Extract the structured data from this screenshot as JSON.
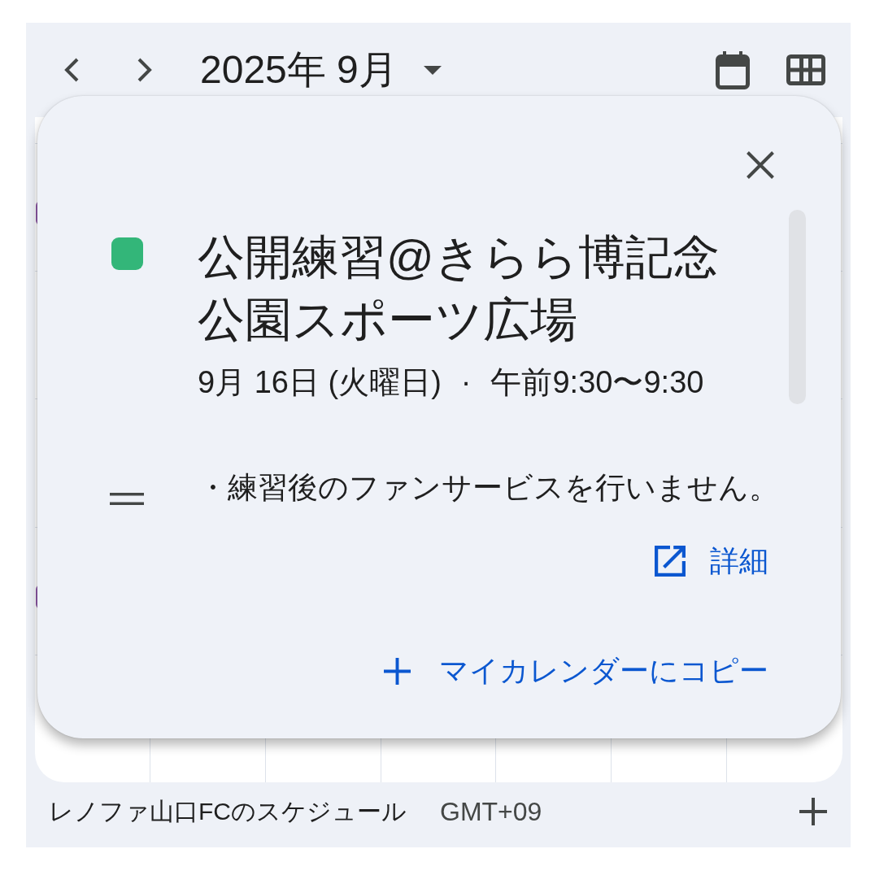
{
  "header": {
    "title": "2025年 9月"
  },
  "event": {
    "color": "#33b679",
    "title": "公開練習@きらら博記念公園スポーツ広場",
    "date": "9月 16日 (火曜日)",
    "separator": "·",
    "time": "午前9:30〜9:30",
    "description": "・練習後のファンサービスを行いません。",
    "link": "詳細",
    "copy_action": "マイカレンダーにコピー"
  },
  "footer": {
    "calendar_name": "レノファ山口FCのスケジュール",
    "timezone": "GMT+09"
  }
}
